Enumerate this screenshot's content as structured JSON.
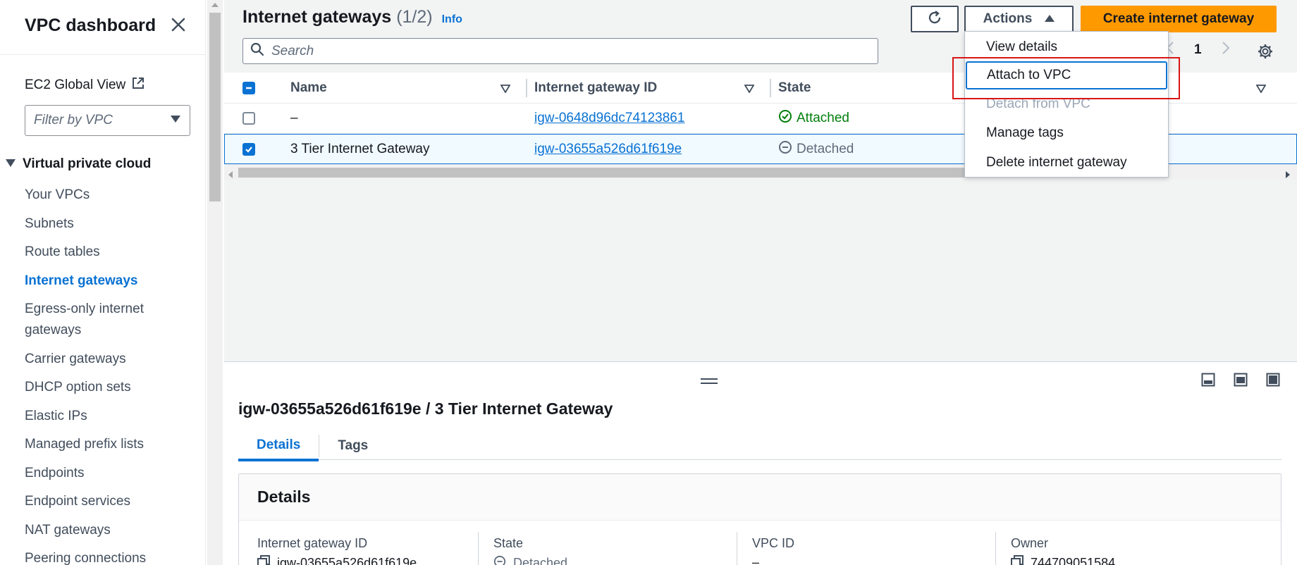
{
  "sidebar": {
    "title": "VPC dashboard",
    "ec2_global_view": "EC2 Global View",
    "filter_placeholder": "Filter by VPC",
    "section_title": "Virtual private cloud",
    "items": [
      {
        "label": "Your VPCs"
      },
      {
        "label": "Subnets"
      },
      {
        "label": "Route tables"
      },
      {
        "label": "Internet gateways"
      },
      {
        "label": "Egress-only internet gateways"
      },
      {
        "label": "Carrier gateways"
      },
      {
        "label": "DHCP option sets"
      },
      {
        "label": "Elastic IPs"
      },
      {
        "label": "Managed prefix lists"
      },
      {
        "label": "Endpoints"
      },
      {
        "label": "Endpoint services"
      },
      {
        "label": "NAT gateways"
      },
      {
        "label": "Peering connections"
      }
    ],
    "active_item": "Internet gateways"
  },
  "header": {
    "title": "Internet gateways",
    "count": "(1/2)",
    "info": "Info",
    "actions_label": "Actions",
    "create_label": "Create internet gateway",
    "search_placeholder": "Search",
    "page_number": "1"
  },
  "table": {
    "columns": [
      "Name",
      "Internet gateway ID",
      "State"
    ],
    "rows": [
      {
        "name": "–",
        "id": "igw-0648d96dc74123861",
        "state": "Attached",
        "selected": false
      },
      {
        "name": "3 Tier Internet Gateway",
        "id": "igw-03655a526d61f619e",
        "state": "Detached",
        "selected": true
      }
    ]
  },
  "actions_menu": {
    "items": [
      {
        "label": "View details",
        "state": "normal"
      },
      {
        "label": "Attach to VPC",
        "state": "focused"
      },
      {
        "label": "Detach from VPC",
        "state": "disabled"
      },
      {
        "label": "Manage tags",
        "state": "normal"
      },
      {
        "label": "Delete internet gateway",
        "state": "normal"
      }
    ]
  },
  "detail": {
    "title": "igw-03655a526d61f619e / 3 Tier Internet Gateway",
    "tabs": [
      "Details",
      "Tags"
    ],
    "active_tab": "Details",
    "section_title": "Details",
    "fields": [
      {
        "label": "Internet gateway ID",
        "value": "igw-03655a526d61f619e"
      },
      {
        "label": "State",
        "value": "Detached"
      },
      {
        "label": "VPC ID",
        "value": "–"
      },
      {
        "label": "Owner",
        "value": "744709051584"
      }
    ]
  },
  "colors": {
    "accent": "#0972d3",
    "primary_button": "#ff9900",
    "attached": "#037f0c",
    "highlight": "#d91515"
  }
}
